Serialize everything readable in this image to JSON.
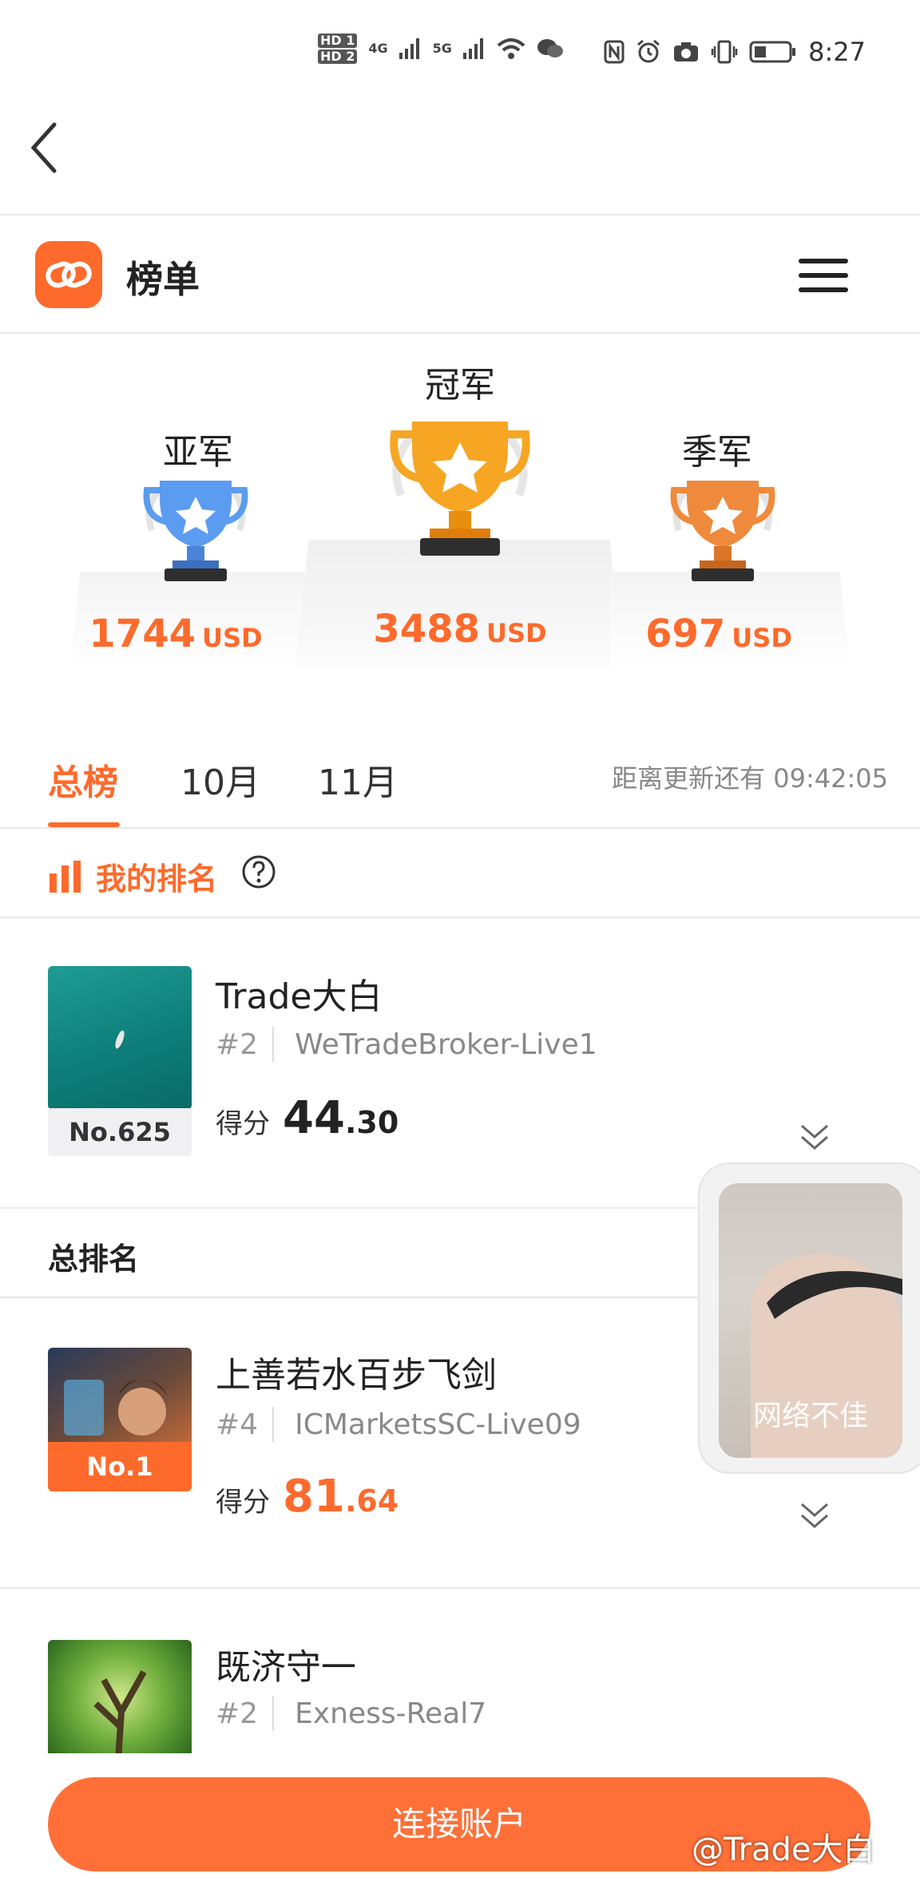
{
  "status_bar": {
    "sim1": "HD 1",
    "sim2": "HD 2",
    "net1": "4G",
    "net2": "5G",
    "time": "8:27"
  },
  "header": {
    "title": "榜单"
  },
  "podium": {
    "first": {
      "label": "冠军",
      "amount": "3488",
      "currency": "USD"
    },
    "second": {
      "label": "亚军",
      "amount": "1744",
      "currency": "USD"
    },
    "third": {
      "label": "季军",
      "amount": "697",
      "currency": "USD"
    }
  },
  "tabs": {
    "items": [
      {
        "label": "总榜"
      },
      {
        "label": "10月"
      },
      {
        "label": "11月"
      }
    ],
    "countdown": "距离更新还有 09:42:05"
  },
  "my_ranking": {
    "title": "我的排名",
    "entry": {
      "name": "Trade大白",
      "index": "#2",
      "server": "WeTradeBroker-Live1",
      "rank": "No.625",
      "score_label": "得分",
      "score_int": "44",
      "score_dec": ".30"
    }
  },
  "overall": {
    "title": "总排名",
    "entries": [
      {
        "name": "上善若水百步飞剑",
        "index": "#4",
        "server": "ICMarketsSC-Live09",
        "rank": "No.1",
        "score_label": "得分",
        "score_int": "81",
        "score_dec": ".64"
      },
      {
        "name": "既济守一",
        "index": "#2",
        "server": "Exness-Real7"
      }
    ]
  },
  "float_video": {
    "status": "网络不佳"
  },
  "bottom": {
    "connect_label": "连接账户",
    "watermark": "@Trade大白"
  },
  "colors": {
    "accent": "#fe6a2c",
    "gold": "#f6a623",
    "silver_blue": "#5b9cf0",
    "bronze": "#ef8a3c"
  }
}
